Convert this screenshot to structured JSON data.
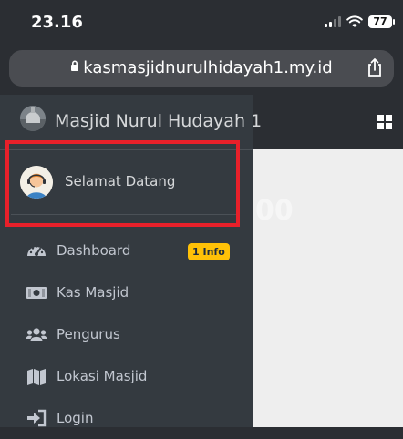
{
  "status_bar": {
    "time": "23.16",
    "battery": "77"
  },
  "browser": {
    "url": "kasmasjidnurulhidayah1.my.id"
  },
  "main": {
    "ghost_value": "00"
  },
  "sidebar": {
    "brand": "Masjid Nurul Hudayah 1",
    "user_name": "Selamat Datang",
    "items": [
      {
        "label": "Dashboard",
        "icon": "tachometer-icon",
        "badge": "1 Info"
      },
      {
        "label": "Kas Masjid",
        "icon": "money-bill-icon"
      },
      {
        "label": "Pengurus",
        "icon": "users-icon"
      },
      {
        "label": "Lokasi Masjid",
        "icon": "map-icon"
      },
      {
        "label": "Login",
        "icon": "sign-in-icon"
      }
    ]
  },
  "colors": {
    "sidebar_bg": "#343a40",
    "highlight": "#e8202a",
    "badge": "#ffc107"
  }
}
